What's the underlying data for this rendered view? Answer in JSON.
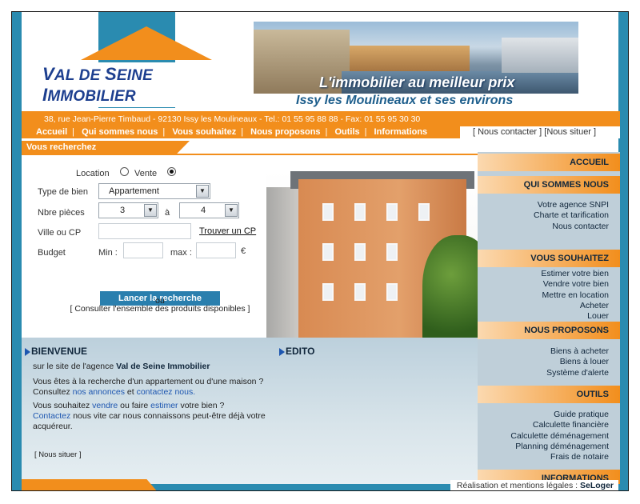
{
  "logo": {
    "name_cap1": "V",
    "name_part1": "AL DE ",
    "name_cap2": "S",
    "name_part2": "EINE ",
    "name_cap3": "I",
    "name_part3": "MMOBILIER"
  },
  "banner": {
    "slogan": "L'immobilier au meilleur prix",
    "tagline": "Issy les Moulineaux et ses environs"
  },
  "header": {
    "address": "38, rue Jean-Pierre Timbaud - 92130 Issy les Moulineaux - Tel.: 01 55 95 88 88 - Fax: 01 55 95 30 30",
    "nav": [
      "Accueil",
      "Qui sommes nous",
      "Vous souhaitez",
      "Nous proposons",
      "Outils",
      "Informations"
    ],
    "contact": "[ Nous contacter ]",
    "situer": "[Nous situer ]"
  },
  "search": {
    "tab_label": "Vous recherchez",
    "location_label": "Location",
    "vente_label": "Vente",
    "selected": "vente",
    "type_label": "Type de bien",
    "type_value": "Appartement",
    "pieces_label": "Nbre  pièces",
    "pieces_min": "3",
    "pieces_a": "à",
    "pieces_max": "4",
    "ville_label": "Ville ou CP",
    "ville_value": "",
    "trouver_cp": "Trouver un CP",
    "budget_label": "Budget",
    "min_label": "Min :",
    "max_label": "max :",
    "currency": "€",
    "button": "Lancer la recherche",
    "ou": "ou",
    "consult_all": "[ Consulter l'ensemble des produits disponibles ]"
  },
  "bienvenue": {
    "title": "BIENVENUE",
    "line1": "sur le site de l'agence ",
    "agency": "Val de Seine Immobilier",
    "p1": "Vous êtes à la recherche d'un appartement ou d'une maison ?",
    "p2_a": "Consultez ",
    "p2_link1": "nos annonces",
    "p2_b": " et ",
    "p2_link2": "contactez nous.",
    "p3_a": "Vous souhaitez ",
    "p3_link1": "vendre",
    "p3_b": " ou faire ",
    "p3_link2": "estimer",
    "p3_c": " votre bien ?",
    "p4_link": "Contactez",
    "p4_a": " nous vite car nous connaissons peut-être déjà votre",
    "p4_b": "acquéreur.",
    "situer": "[ Nous situer ]"
  },
  "edito": {
    "title": "EDITO"
  },
  "sidebar": {
    "accueil": "ACCUEIL",
    "qui": {
      "title": "QUI SOMMES NOUS",
      "items": [
        "Votre agence SNPI",
        "Charte et tarification",
        "Nous contacter"
      ]
    },
    "souhaitez": {
      "title": "VOUS SOUHAITEZ",
      "items": [
        "Estimer votre bien",
        "Vendre votre bien",
        "Mettre en location",
        "Acheter",
        "Louer"
      ]
    },
    "proposons": {
      "title": "NOUS PROPOSONS",
      "items": [
        "Biens à acheter",
        "Biens à louer",
        "Système d'alerte"
      ]
    },
    "outils": {
      "title": "OUTILS",
      "items": [
        "Guide pratique",
        "Calculette financière",
        "Calculette déménagement",
        "Planning déménagement",
        "Frais de notaire"
      ]
    },
    "informations": "INFORMATIONS"
  },
  "footer": {
    "text": "Réalisation et mentions légales : ",
    "brand": "SeLoger"
  },
  "colors": {
    "orange": "#f28e1c",
    "teal": "#2a8bb0",
    "navy": "#1d3f8f"
  }
}
